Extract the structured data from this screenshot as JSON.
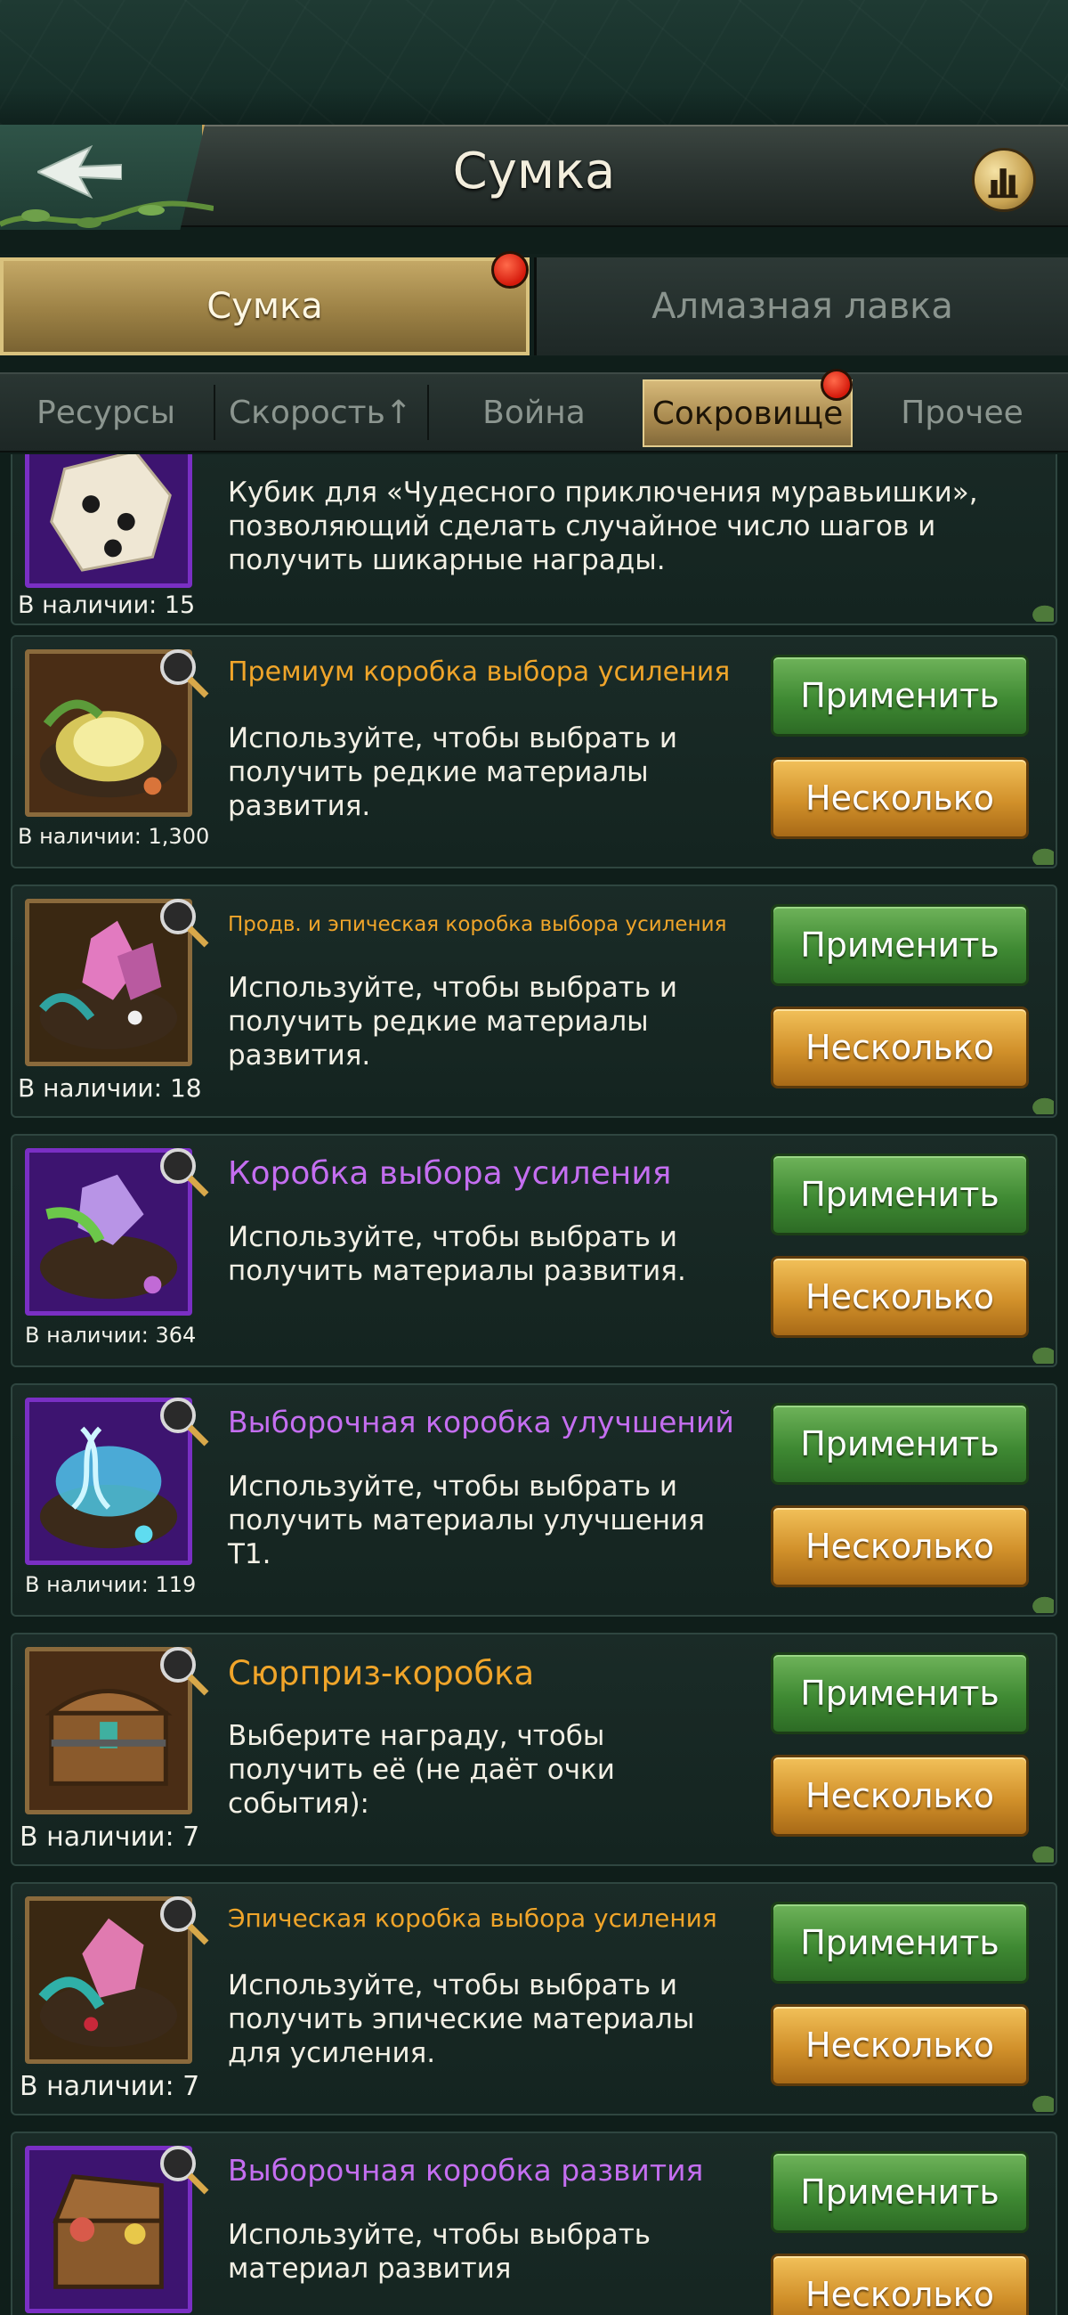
{
  "header": {
    "title": "Сумка"
  },
  "main_tabs": [
    {
      "label": "Сумка",
      "active": true
    },
    {
      "label": "Алмазная лавка",
      "active": false
    }
  ],
  "sub_tabs": [
    {
      "label": "Ресурсы"
    },
    {
      "label": "Скорость↑"
    },
    {
      "label": "Война"
    },
    {
      "label": "Сокровище",
      "active": true
    },
    {
      "label": "Прочее"
    }
  ],
  "buttons": {
    "apply": "Применить",
    "multiple": "Несколько"
  },
  "items": [
    {
      "name": "",
      "description": "Кубик для «Чудесного приключения муравьишки», позволяющий сделать случайное число шагов и получить шикарные награды.",
      "stock": "В наличии: 15",
      "icon": "dice-icon"
    },
    {
      "name": "Премиум коробка выбора усиления",
      "description": "Используйте, чтобы выбрать и получить редкие материалы развития.",
      "stock": "В наличии: 1,300",
      "icon": "nest-box-icon"
    },
    {
      "name": "Продв. и эпическая коробка выбора усиления",
      "description": "Используйте, чтобы выбрать и получить редкие материалы развития.",
      "stock": "В наличии: 18",
      "icon": "crystal-nest-icon"
    },
    {
      "name": "Коробка выбора усиления",
      "description": "Используйте, чтобы выбрать и получить материалы развития.",
      "stock": "В наличии: 364",
      "icon": "purple-nest-icon"
    },
    {
      "name": "Выборочная коробка улучшений",
      "description": "Используйте, чтобы выбрать и получить материалы улучшения Т1.",
      "stock": "В наличии: 119",
      "icon": "dna-nest-icon"
    },
    {
      "name": "Сюрприз-коробка",
      "description": "Выберите награду, чтобы получить её (не даёт очки события):",
      "stock": "В наличии: 7",
      "icon": "treasure-chest-icon"
    },
    {
      "name": "Эпическая коробка выбора усиления",
      "description": "Используйте, чтобы выбрать и получить эпические материалы для усиления.",
      "stock": "В наличии: 7",
      "icon": "epic-nest-icon"
    },
    {
      "name": "Выборочная коробка развития",
      "description": "Используйте, чтобы выбрать материал развития",
      "stock": "",
      "icon": "open-chest-icon"
    }
  ],
  "colors": {
    "gold_text": "#f0a52a",
    "purple_text": "#c46ef0",
    "apply_green": "#3f8a33",
    "multi_orange": "#d1902a",
    "notification_red": "#d51a0c"
  }
}
